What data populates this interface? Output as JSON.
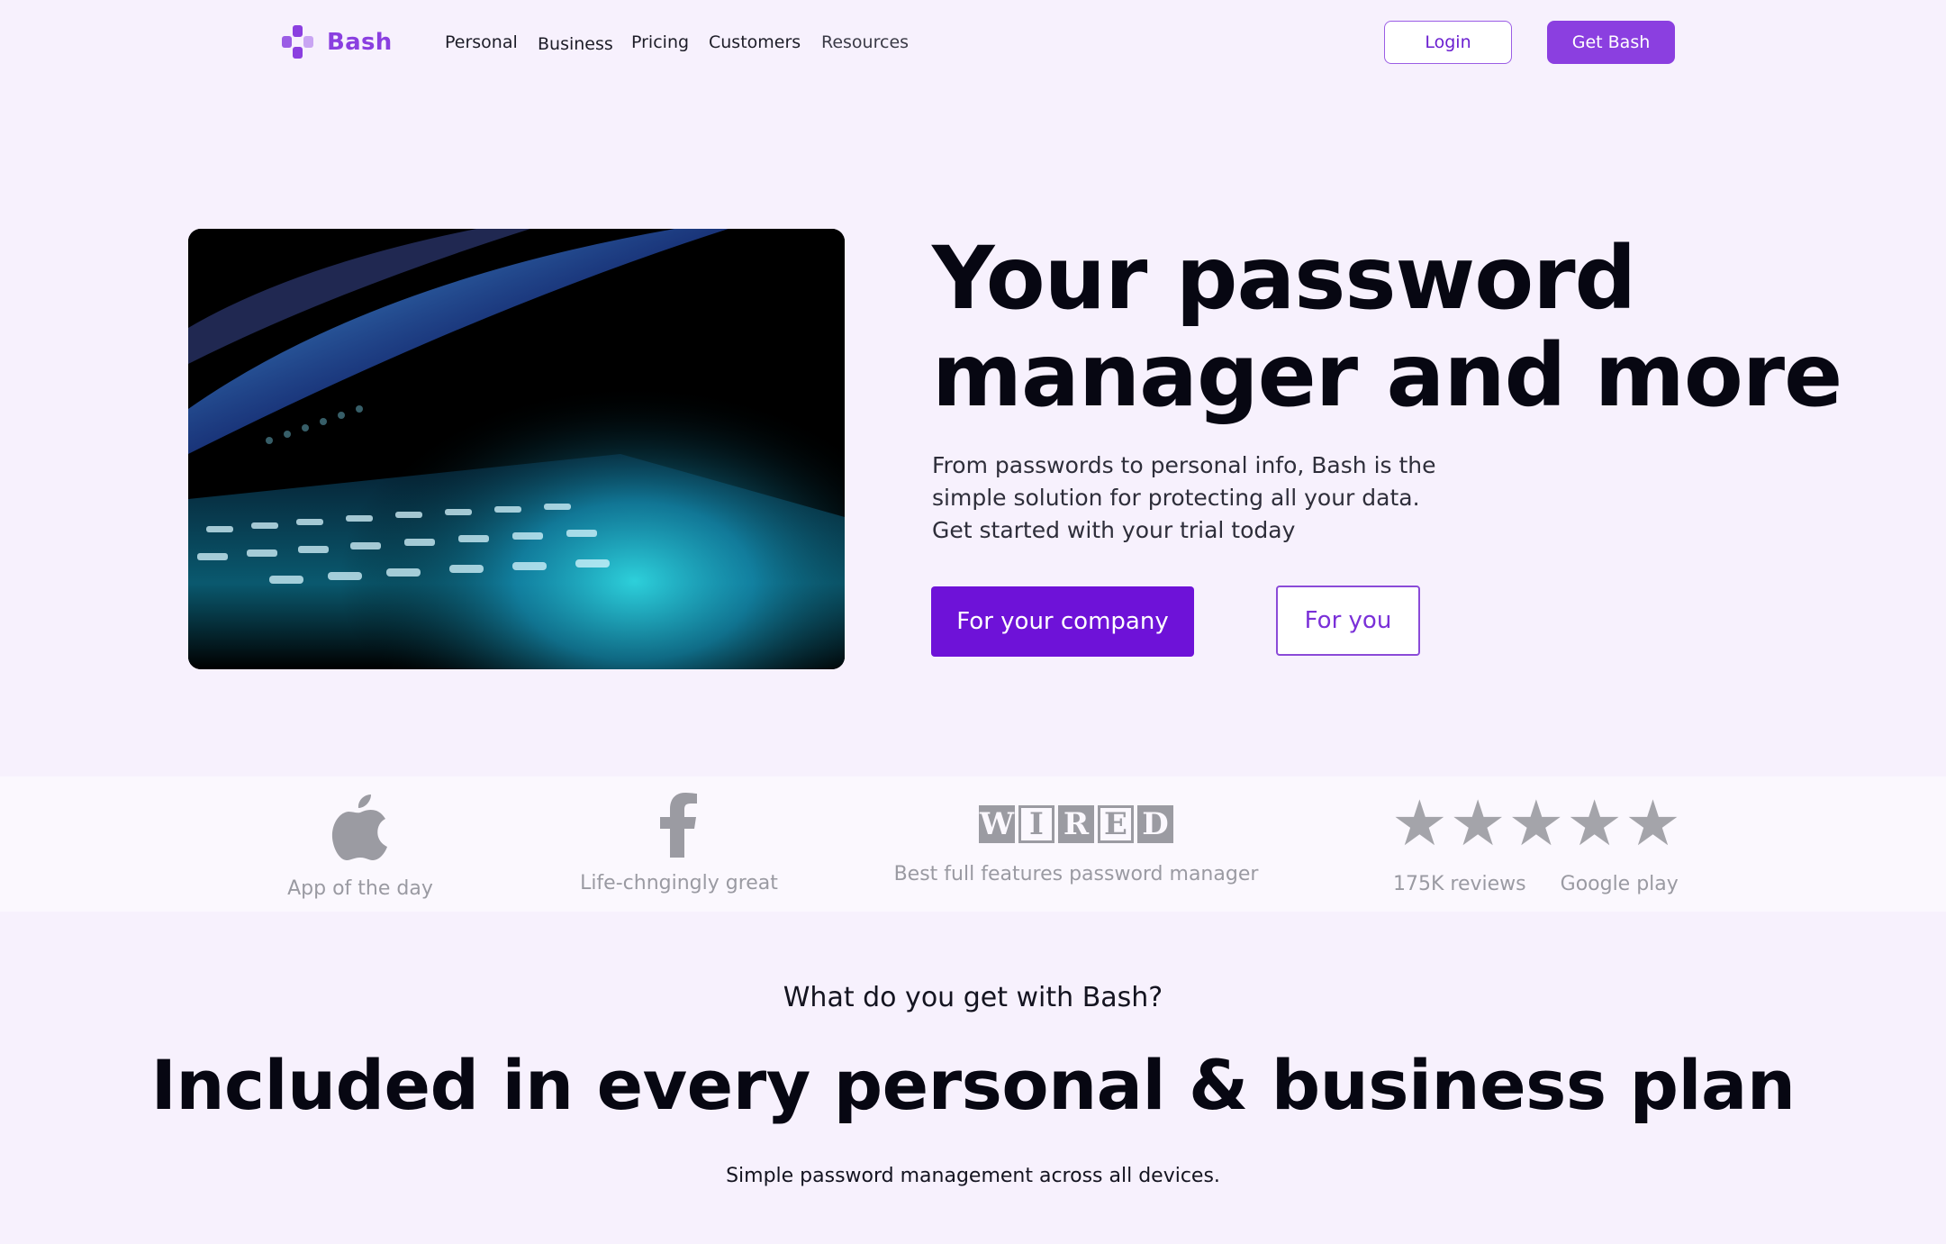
{
  "brand": {
    "name": "Bash",
    "accent": "#8b3fe0",
    "cta": "#6e12d8"
  },
  "nav": {
    "links": [
      "Personal",
      "Business",
      "Pricing",
      "Customers",
      "Resources"
    ],
    "login_label": "Login",
    "get_label": "Get Bash"
  },
  "hero": {
    "title_line1": "Your password",
    "title_line2": "manager and more",
    "subtitle_line1": "From passwords to personal info,  Bash is the",
    "subtitle_line2": "simple solution for protecting all your data.",
    "subtitle_line3": "Get started with your trial today",
    "btn_company": "For your company",
    "btn_you": "For you"
  },
  "press": {
    "apple_caption": "App of the day",
    "facebook_caption": "Life-chngingly great",
    "wired_letters": [
      "W",
      "I",
      "R",
      "E",
      "D"
    ],
    "wired_caption": "Best full features password manager",
    "stars_rating": 5,
    "reviews_caption": "175K reviews",
    "store_caption": "Google play"
  },
  "features": {
    "eyebrow": "What do you get with Bash?",
    "title": "Included in every personal & business plan",
    "subtitle": "Simple password management across all devices."
  }
}
